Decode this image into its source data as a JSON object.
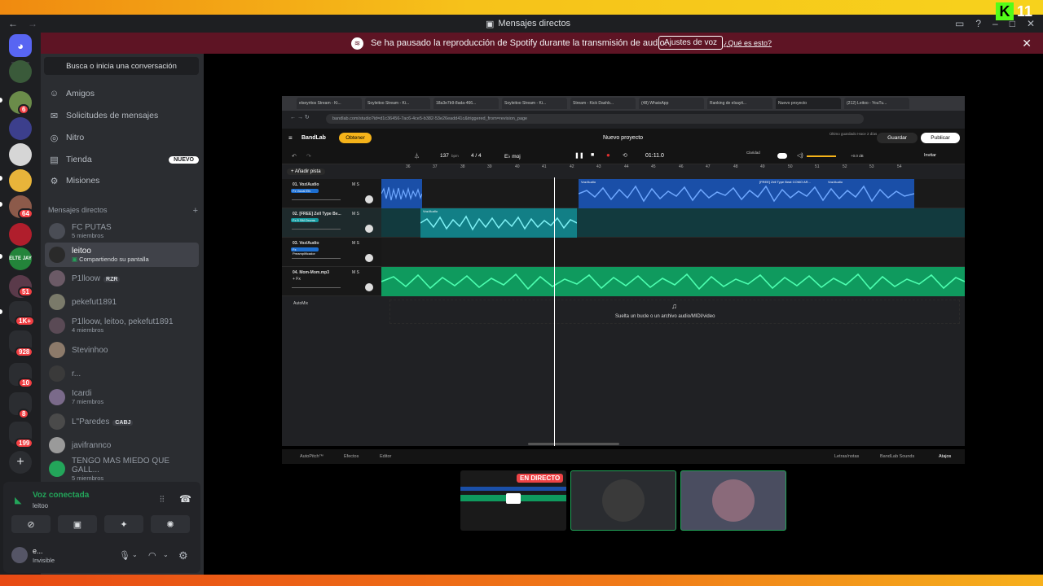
{
  "window": {
    "title": "Mensajes directos"
  },
  "kick": {
    "letter": "K",
    "count": "11"
  },
  "banner": {
    "message": "Se ha pausado la reproducción de Spotify durante la transmisión de audio.",
    "button": "Ajustes de voz",
    "link": "¿Qué es esto?"
  },
  "servers": {
    "badges": [
      "6",
      "64",
      "51",
      "1K+",
      "928",
      "10",
      "8",
      "199"
    ],
    "folder_label": "ELTE JAY"
  },
  "search": {
    "placeholder": "Busca o inicia una conversación"
  },
  "nav": [
    {
      "label": "Amigos",
      "icon": "friends-icon"
    },
    {
      "label": "Solicitudes de mensajes",
      "icon": "mail-icon"
    },
    {
      "label": "Nitro",
      "icon": "nitro-icon"
    },
    {
      "label": "Tienda",
      "icon": "shop-icon",
      "badge": "NUEVO"
    },
    {
      "label": "Misiones",
      "icon": "quests-icon"
    }
  ],
  "dm_header": {
    "label": "Mensajes directos",
    "add": "+"
  },
  "dms": [
    {
      "name": "FC PUTAS",
      "sub": "5 miembros"
    },
    {
      "name": "leitoo",
      "sub": "Compartiendo su pantalla",
      "selected": true
    },
    {
      "name": "P1lloow",
      "tag": "RZR"
    },
    {
      "name": "pekefut1891",
      "sub": ""
    },
    {
      "name": "P1lloow, leitoo, pekefut1891",
      "sub": "4 miembros"
    },
    {
      "name": "Stevinhoo",
      "sub": ""
    },
    {
      "name": "r...",
      "sub": ""
    },
    {
      "name": "Icardi",
      "sub": "7 miembros"
    },
    {
      "name": "L\"Paredes",
      "tag": "CABJ"
    },
    {
      "name": "javifrannco",
      "sub": ""
    },
    {
      "name": "TENGO MAS MIEDO QUE GALL...",
      "sub": "5 miembros"
    }
  ],
  "voice": {
    "status": "Voz conectada",
    "channel": "leitoo"
  },
  "user": {
    "name": "e...",
    "status": "Invisible"
  },
  "browser": {
    "tabs": [
      "elseyritos Stream - Ki...",
      "Soyleitoo Stream - Ki...",
      "18a3e7b9-8ada-466...",
      "Soyleitoo Stream - Ki...",
      "Stream - Kick Dashb...",
      "(48) WhatsApp",
      "Ranking de elsayit...",
      "Nuevo proyecto",
      "(212) Leitoo - YouTu..."
    ],
    "url": "bandlab.com/studio?id=d1c36456-7ac6-4ce5-b382-53e26eadd41c&triggered_from=revision_page"
  },
  "bandlab": {
    "logo": "BandLab",
    "obtener": "Obtener",
    "project": "Nuevo proyecto",
    "saved": "Último guardado Hace 2 días",
    "save": "Guardar",
    "publish": "Publicar",
    "bpm": "137",
    "bpm_unit": "bpm",
    "meter": "4 / 4",
    "key": "E♭ moj",
    "time": "01:11.0",
    "clarity": "Claridad",
    "db": "+0.0 dB",
    "invite": "Invitar",
    "add_track": "+ Añadir pista",
    "ruler": [
      "36",
      "37",
      "38",
      "39",
      "40",
      "41",
      "42",
      "43",
      "44",
      "45",
      "46",
      "47",
      "48",
      "49",
      "50",
      "51",
      "52",
      "53",
      "54"
    ],
    "tracks": [
      {
        "name": "01. Voz/Audio",
        "chip": "Fx Vocal Efx"
      },
      {
        "name": "02. [FREE] Zell Type Be...",
        "chip": "Fx 5 SM Drums"
      },
      {
        "name": "03. Voz/Audio",
        "chip": "Fx Preamplificador"
      },
      {
        "name": "04. Mom-Mom.mp3",
        "chip": "+ Fx"
      }
    ],
    "clip_labels": [
      "Voz/Audio",
      "Voz/Audio",
      "[FREE] Zell Type Beat COMO AR...",
      "Voz/Audio"
    ],
    "automix": "AutoMix",
    "drop_hint": "Suelta un bucle o un archivo audio/MIDI/video",
    "bottom_left": [
      "AutoPitch™",
      "Efectos",
      "Editor"
    ],
    "bottom_right": [
      "Letras/notas",
      "BandLab Sounds",
      "Atajos"
    ]
  },
  "stream": {
    "live": "EN DIRECTO"
  },
  "colors": {
    "accent": "#5865f2",
    "green": "#23a55a",
    "banner": "#5e1424",
    "wave_blue": "#2f7bff",
    "wave_teal": "#1dbfc4",
    "wave_green": "#19d68a"
  }
}
